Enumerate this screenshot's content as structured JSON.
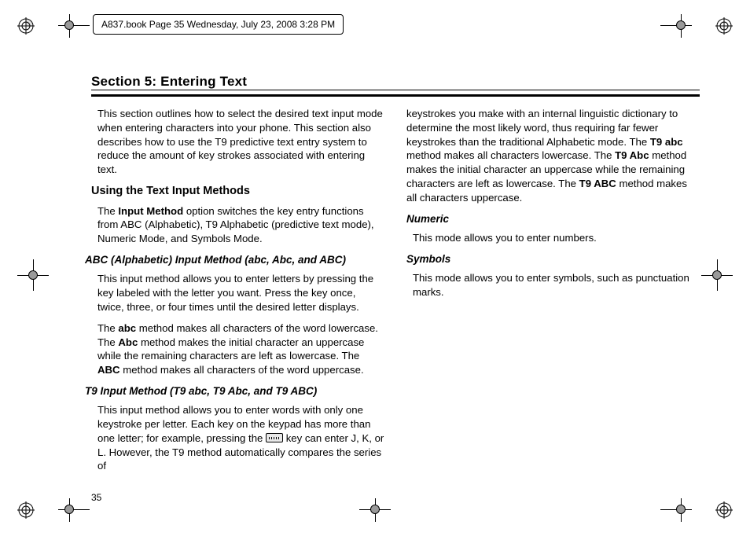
{
  "meta": {
    "tagline": "A837.book  Page 35  Wednesday, July 23, 2008  3:28 PM",
    "page_number": "35"
  },
  "section": {
    "title": "Section 5: Entering Text"
  },
  "left": {
    "intro": "This section outlines how to select the desired text input mode when entering characters into your phone. This section also describes how to use the T9 predictive text entry system to reduce the amount of key strokes associated with entering text.",
    "h2_methods": "Using the Text Input Methods",
    "methods_p1a": "The ",
    "methods_p1b": "Input Method",
    "methods_p1c": " option switches the key entry functions from ABC (Alphabetic), T9 Alphabetic (predictive text mode), Numeric Mode, and Symbols Mode.",
    "h3_abc": "ABC (Alphabetic) Input Method (abc, Abc, and ABC)",
    "abc_p1": "This input method allows you to enter letters by pressing the key labeled with the letter you want. Press the key once, twice, three, or four times until the desired letter displays.",
    "abc_p2a": "The ",
    "abc_p2b": "abc",
    "abc_p2c": " method makes all characters of the word lowercase. The ",
    "abc_p2d": "Abc",
    "abc_p2e": " method makes the initial character an uppercase while the remaining characters are left as lowercase. The ",
    "abc_p2f": "ABC",
    "abc_p2g": " method makes all characters of the word uppercase.",
    "h3_t9": "T9 Input Method (T9 abc, T9 Abc, and T9 ABC)",
    "t9_p1a": "This input method allows you to enter words with only one keystroke per letter. Each key on the keypad has more than one letter; for example, pressing the ",
    "t9_p1b": " key can enter J, K, or L. However, the T9 method automatically compares the series of"
  },
  "right": {
    "cont_a": "keystrokes you make with an internal linguistic dictionary to determine the most likely word, thus requiring far fewer keystrokes than the traditional Alphabetic mode. The ",
    "cont_b": "T9 abc",
    "cont_c": " method makes all characters lowercase. The ",
    "cont_d": "T9 Abc",
    "cont_e": " method makes the initial character an uppercase while the remaining characters are left as lowercase. The ",
    "cont_f": "T9 ABC",
    "cont_g": " method makes all characters uppercase.",
    "h3_numeric": "Numeric",
    "numeric_p": "This mode allows you to enter numbers.",
    "h3_symbols": "Symbols",
    "symbols_p": "This mode allows you to enter symbols, such as punctuation marks."
  }
}
